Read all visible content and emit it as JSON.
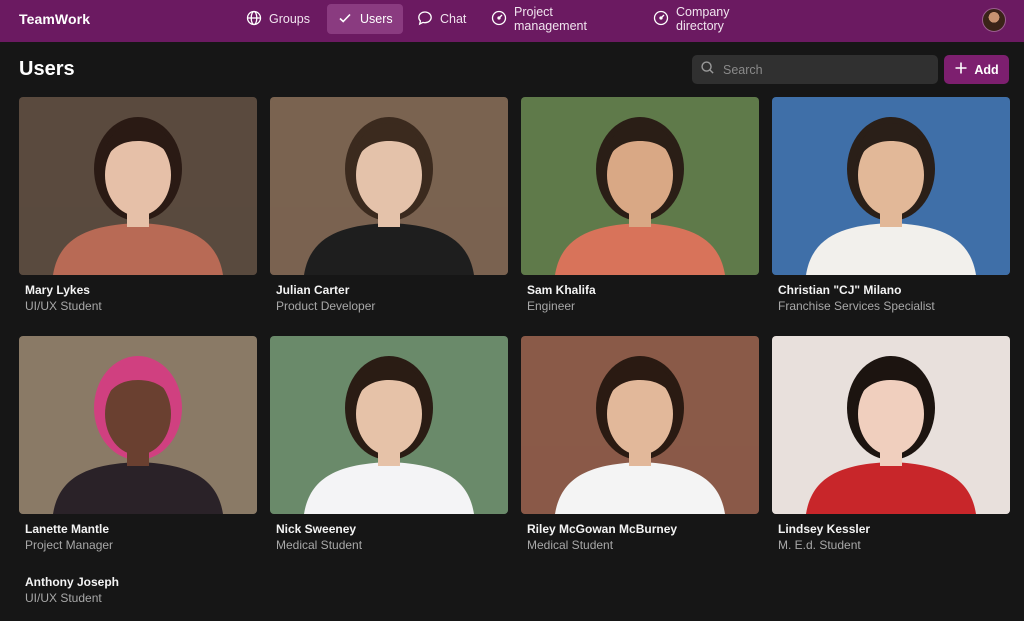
{
  "app": {
    "brand": "TeamWork"
  },
  "nav": [
    {
      "label": "Groups",
      "icon": "globe-icon"
    },
    {
      "label": "Users",
      "icon": "check-icon",
      "active": true
    },
    {
      "label": "Chat",
      "icon": "chat-bubble-icon"
    },
    {
      "label": "Project management",
      "icon": "gauge-icon"
    },
    {
      "label": "Company directory",
      "icon": "gauge-icon"
    }
  ],
  "page": {
    "title": "Users"
  },
  "search": {
    "placeholder": "Search",
    "value": ""
  },
  "actions": {
    "add_label": "Add"
  },
  "users": [
    {
      "name": "Mary Lykes",
      "role": "UI/UX Student",
      "photo": {
        "bg": "#5a4a3e",
        "skin": "#e6c0a8",
        "hair": "#2a1a14",
        "shirt": "#b86a55"
      }
    },
    {
      "name": "Julian Carter",
      "role": "Product Developer",
      "photo": {
        "bg": "#7a6350",
        "skin": "#e4c2aa",
        "hair": "#3b2a1e",
        "shirt": "#1e1e1e"
      }
    },
    {
      "name": "Sam Khalifa",
      "role": "Engineer",
      "photo": {
        "bg": "#5f7a4a",
        "skin": "#d9a885",
        "hair": "#2a1e16",
        "shirt": "#d8735a"
      }
    },
    {
      "name": "Christian \"CJ\" Milano",
      "role": "Franchise Services Specialist",
      "photo": {
        "bg": "#3f6fa8",
        "skin": "#e2b898",
        "hair": "#2a1f18",
        "shirt": "#f2f0ec"
      }
    },
    {
      "name": "Lanette Mantle",
      "role": "Project Manager",
      "photo": {
        "bg": "#8a7a66",
        "skin": "#6a4030",
        "hair": "#d04080",
        "shirt": "#2a2228"
      }
    },
    {
      "name": "Nick Sweeney",
      "role": "Medical Student",
      "photo": {
        "bg": "#6a8a6a",
        "skin": "#e6c2a8",
        "hair": "#2a1c14",
        "shirt": "#f4f4f6"
      }
    },
    {
      "name": "Riley McGowan McBurney",
      "role": "Medical Student",
      "photo": {
        "bg": "#8a5a48",
        "skin": "#e2b89a",
        "hair": "#2a1a12",
        "shirt": "#f4f4f4"
      }
    },
    {
      "name": "Lindsey Kessler",
      "role": "M. E.d. Student",
      "photo": {
        "bg": "#e8e0dc",
        "skin": "#f0cfbe",
        "hair": "#1c1410",
        "shirt": "#c8262a"
      }
    },
    {
      "name": "Anthony Joseph",
      "role": "UI/UX Student"
    }
  ],
  "colors": {
    "topbar": "#6b1a61",
    "accent": "#7d1f6f",
    "background": "#161616"
  }
}
